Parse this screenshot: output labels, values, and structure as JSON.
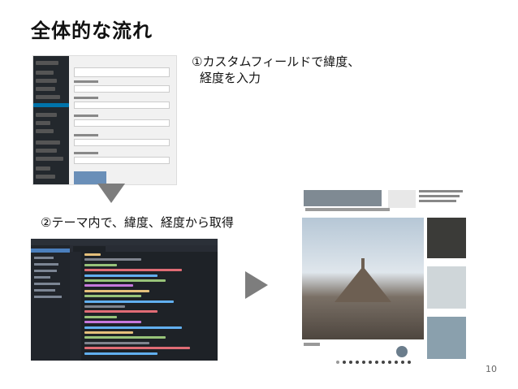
{
  "slide": {
    "title": "全体的な流れ",
    "caption_1_line1": "①カスタムフィールドで緯度、",
    "caption_1_line2": "経度を入力",
    "caption_2": "②テーマ内で、緯度、経度から取得",
    "page_number": "10"
  },
  "colors": {
    "arrow": "#7d7d7d",
    "wp_sidebar": "#23282d",
    "wp_active": "#0073aa",
    "editor_bg": "#1e2227"
  },
  "icons": {
    "step_arrow_down": "down-triangle",
    "step_arrow_right": "right-triangle"
  }
}
